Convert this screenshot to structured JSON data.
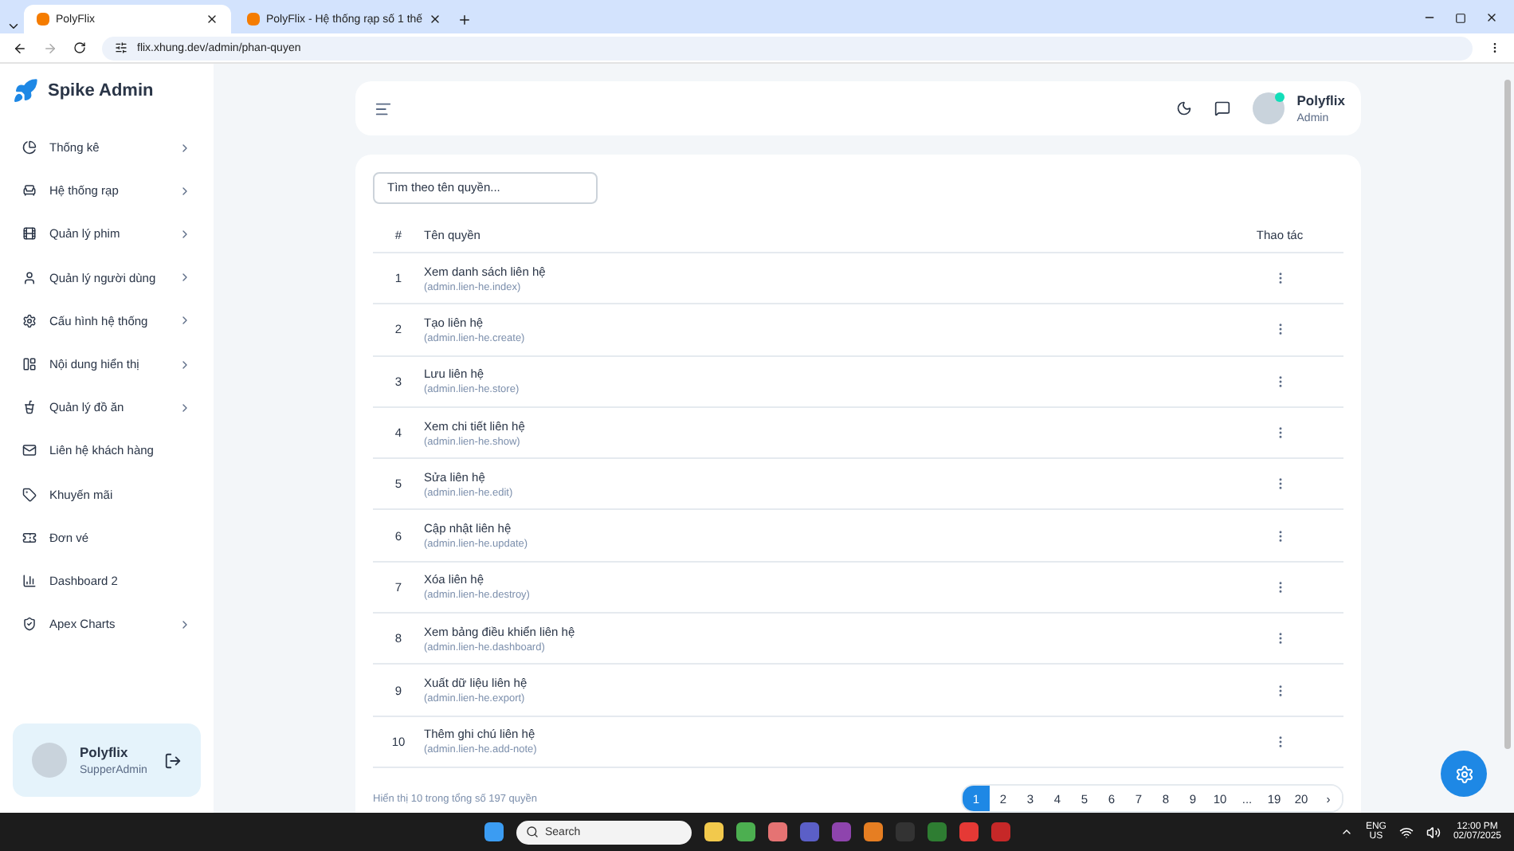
{
  "browser": {
    "tabs": [
      {
        "title": "PolyFlix",
        "selected": true
      },
      {
        "title": "PolyFlix - Hệ thống rạp số 1 thế",
        "selected": false
      }
    ],
    "url": "flix.xhung.dev/admin/phan-quyen"
  },
  "sidebar": {
    "brand": "Spike Admin",
    "items": [
      {
        "label": "Thống kê",
        "has_submenu": true
      },
      {
        "label": "Hệ thống rạp",
        "has_submenu": true
      },
      {
        "label": "Quản lý phim",
        "has_submenu": true
      },
      {
        "label": "Quản lý người dùng",
        "has_submenu": true
      },
      {
        "label": "Cấu hình hệ thống",
        "has_submenu": true
      },
      {
        "label": "Nội dung hiển thị",
        "has_submenu": true
      },
      {
        "label": "Quản lý đồ ăn",
        "has_submenu": true
      },
      {
        "label": "Liên hệ khách hàng",
        "has_submenu": false
      },
      {
        "label": "Khuyến mãi",
        "has_submenu": false
      },
      {
        "label": "Đơn vé",
        "has_submenu": false
      },
      {
        "label": "Dashboard 2",
        "has_submenu": false
      },
      {
        "label": "Apex Charts",
        "has_submenu": true
      }
    ],
    "user": {
      "name": "Polyflix",
      "role": "SupperAdmin"
    }
  },
  "header": {
    "user": {
      "name": "Polyflix",
      "role": "Admin",
      "online": true
    }
  },
  "search": {
    "placeholder": "Tìm theo tên quyền..."
  },
  "table": {
    "columns": [
      "#",
      "Tên quyền",
      "Thao tác"
    ],
    "rows": [
      {
        "index": "1",
        "name": "Xem danh sách liên hệ",
        "code": "(admin.lien-he.index)"
      },
      {
        "index": "2",
        "name": "Tạo liên hệ",
        "code": "(admin.lien-he.create)"
      },
      {
        "index": "3",
        "name": "Lưu liên hệ",
        "code": "(admin.lien-he.store)"
      },
      {
        "index": "4",
        "name": "Xem chi tiết liên hệ",
        "code": "(admin.lien-he.show)"
      },
      {
        "index": "5",
        "name": "Sửa liên hệ",
        "code": "(admin.lien-he.edit)"
      },
      {
        "index": "6",
        "name": "Cập nhật liên hệ",
        "code": "(admin.lien-he.update)"
      },
      {
        "index": "7",
        "name": "Xóa liên hệ",
        "code": "(admin.lien-he.destroy)"
      },
      {
        "index": "8",
        "name": "Xem bảng điều khiển liên hệ",
        "code": "(admin.lien-he.dashboard)"
      },
      {
        "index": "9",
        "name": "Xuất dữ liệu liên hệ",
        "code": "(admin.lien-he.export)"
      },
      {
        "index": "10",
        "name": "Thêm ghi chú liên hệ",
        "code": "(admin.lien-he.add-note)"
      }
    ]
  },
  "footer": {
    "summary": "Hiển thị 10 trong tổng số 197 quyền",
    "pages": [
      {
        "label": "1",
        "selected": true
      },
      {
        "label": "2",
        "selected": false
      },
      {
        "label": "3",
        "selected": false
      },
      {
        "label": "4",
        "selected": false
      },
      {
        "label": "5",
        "selected": false
      },
      {
        "label": "6",
        "selected": false
      },
      {
        "label": "7",
        "selected": false
      },
      {
        "label": "8",
        "selected": false
      },
      {
        "label": "9",
        "selected": false
      },
      {
        "label": "10",
        "selected": false
      },
      {
        "label": "...",
        "selected": false
      },
      {
        "label": "19",
        "selected": false
      },
      {
        "label": "20",
        "selected": false
      },
      {
        "label": "›",
        "selected": false
      }
    ]
  },
  "taskbar": {
    "search_placeholder": "Search",
    "language": "ENG",
    "region": "US",
    "time": "12:00 PM",
    "date": "02/07/2025"
  }
}
